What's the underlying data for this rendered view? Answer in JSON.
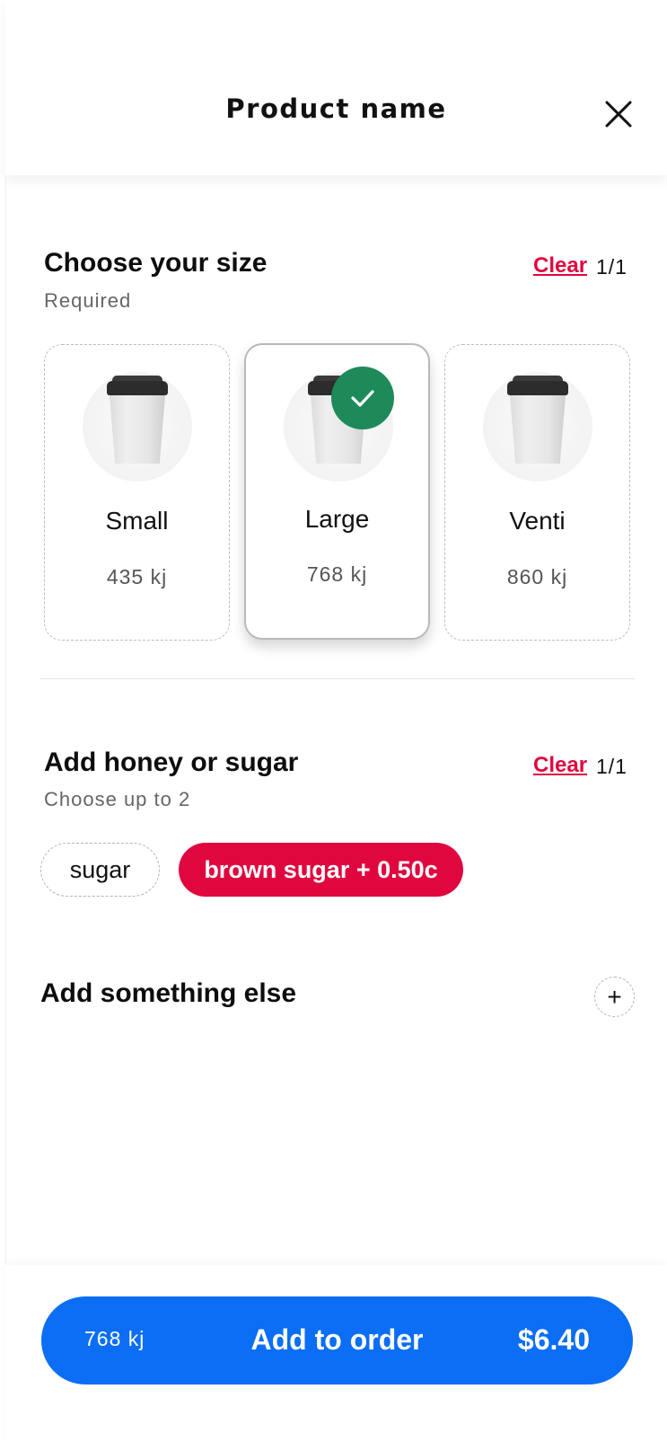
{
  "header": {
    "title": "Product name",
    "close_icon": "close-icon"
  },
  "size_section": {
    "title": "Choose your size",
    "subtitle": "Required",
    "clear_label": "Clear",
    "counter": "1/1",
    "options": [
      {
        "name": "Small",
        "kj": "435 kj",
        "selected": false
      },
      {
        "name": "Large",
        "kj": "768 kj",
        "selected": true
      },
      {
        "name": "Venti",
        "kj": "860 kj",
        "selected": false
      }
    ],
    "selected_color": "#1e8a5a"
  },
  "sweetener_section": {
    "title": "Add honey or sugar",
    "subtitle": "Choose up to 2",
    "clear_label": "Clear",
    "counter": "1/1",
    "options": [
      {
        "label": "sugar",
        "selected": false
      },
      {
        "label": "brown sugar + 0.50c",
        "selected": true
      }
    ],
    "accent_color": "#e0073f"
  },
  "extras": {
    "title": "Add something else",
    "plus_icon": "plus-icon"
  },
  "order": {
    "kj": "768 kj",
    "label": "Add to order",
    "price": "$6.40",
    "color": "#0b6ef5"
  }
}
